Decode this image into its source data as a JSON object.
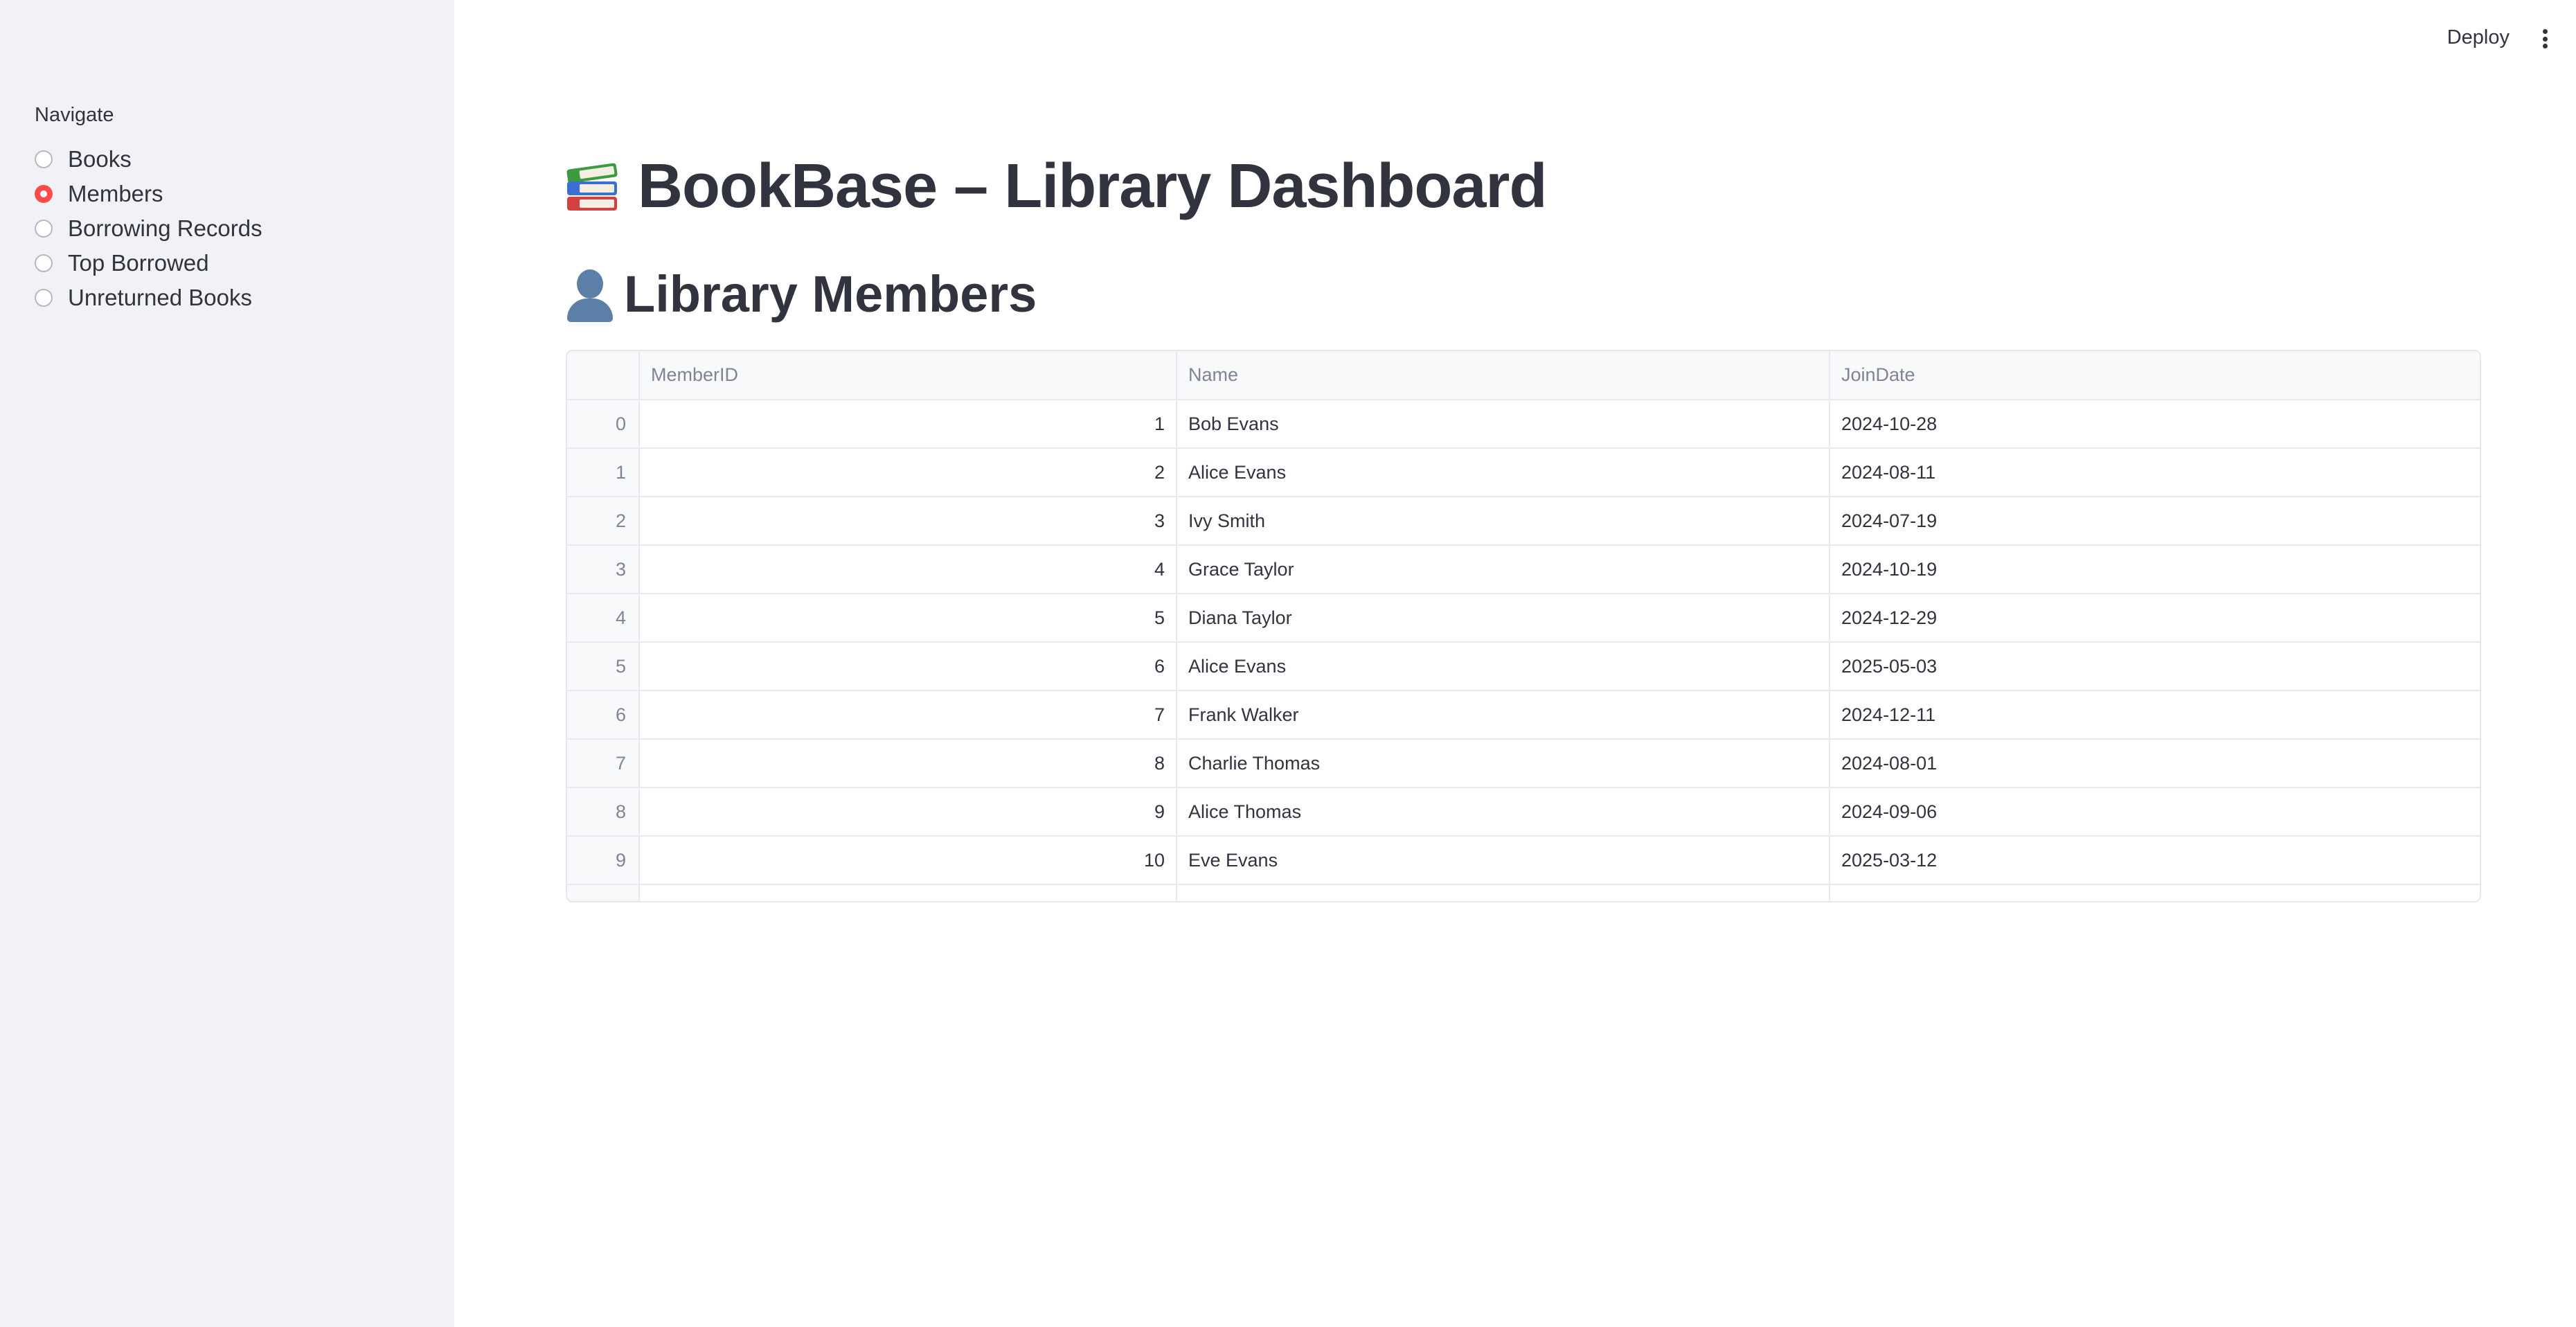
{
  "header": {
    "deploy_label": "Deploy"
  },
  "sidebar": {
    "nav_label": "Navigate",
    "items": [
      {
        "label": "Books",
        "selected": false
      },
      {
        "label": "Members",
        "selected": true
      },
      {
        "label": "Borrowing Records",
        "selected": false
      },
      {
        "label": "Top Borrowed",
        "selected": false
      },
      {
        "label": "Unreturned Books",
        "selected": false
      }
    ],
    "accent_color": "#ff4b4b"
  },
  "main": {
    "title": "BookBase – Library Dashboard",
    "title_icon": "books-icon",
    "subtitle": "Library Members",
    "subtitle_icon": "user-silhouette-icon",
    "table": {
      "columns": [
        "",
        "MemberID",
        "Name",
        "JoinDate"
      ],
      "rows": [
        [
          "0",
          "1",
          "Bob Evans",
          "2024-10-28"
        ],
        [
          "1",
          "2",
          "Alice Evans",
          "2024-08-11"
        ],
        [
          "2",
          "3",
          "Ivy Smith",
          "2024-07-19"
        ],
        [
          "3",
          "4",
          "Grace Taylor",
          "2024-10-19"
        ],
        [
          "4",
          "5",
          "Diana Taylor",
          "2024-12-29"
        ],
        [
          "5",
          "6",
          "Alice Evans",
          "2025-05-03"
        ],
        [
          "6",
          "7",
          "Frank Walker",
          "2024-12-11"
        ],
        [
          "7",
          "8",
          "Charlie Thomas",
          "2024-08-01"
        ],
        [
          "8",
          "9",
          "Alice Thomas",
          "2024-09-06"
        ],
        [
          "9",
          "10",
          "Eve Evans",
          "2025-03-12"
        ]
      ]
    }
  }
}
